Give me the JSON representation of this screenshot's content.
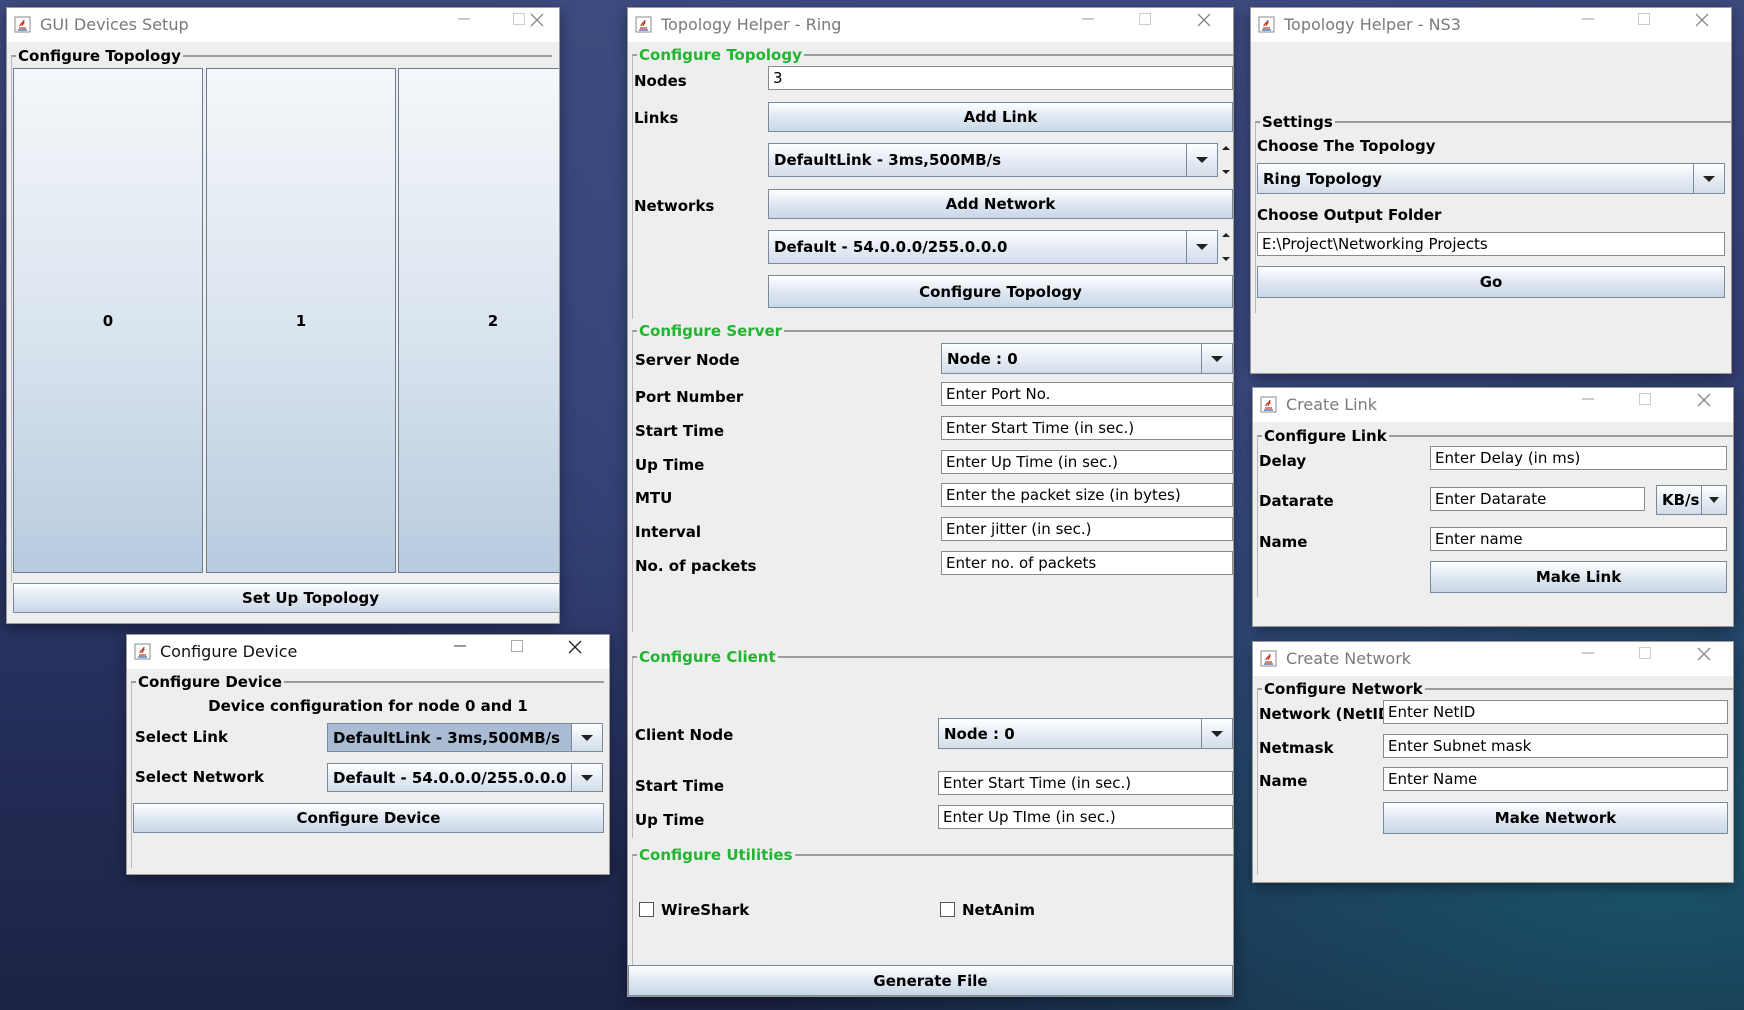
{
  "gui_devices": {
    "title": "GUI Devices Setup",
    "group": "Configure Topology",
    "nodes": [
      "0",
      "1",
      "2"
    ],
    "setup_button": "Set Up Topology"
  },
  "configure_device": {
    "title": "Configure Device",
    "group": "Configure Device",
    "info": "Device configuration for node 0 and 1",
    "select_link_label": "Select Link",
    "select_link_value": "DefaultLink - 3ms,500MB/s",
    "select_network_label": "Select Network",
    "select_network_value": "Default - 54.0.0.0/255.0.0.0",
    "button": "Configure Device"
  },
  "ring": {
    "title": "Topology Helper - Ring",
    "topology": {
      "group": "Configure Topology",
      "nodes_label": "Nodes",
      "nodes_value": "3",
      "links_label": "Links",
      "add_link": "Add Link",
      "link_value": "DefaultLink - 3ms,500MB/s",
      "networks_label": "Networks",
      "add_network": "Add Network",
      "network_value": "Default - 54.0.0.0/255.0.0.0",
      "configure_button": "Configure Topology"
    },
    "server": {
      "group": "Configure Server",
      "server_node_label": "Server Node",
      "server_node_value": "Node : 0",
      "port_label": "Port Number",
      "port_placeholder": "Enter Port No.",
      "start_label": "Start Time",
      "start_placeholder": "Enter Start Time (in sec.)",
      "up_label": "Up Time",
      "up_placeholder": "Enter Up Time (in sec.)",
      "mtu_label": "MTU",
      "mtu_placeholder": "Enter the packet size (in bytes)",
      "interval_label": "Interval",
      "interval_placeholder": "Enter jitter (in sec.)",
      "packets_label": "No. of packets",
      "packets_placeholder": "Enter no. of packets"
    },
    "client": {
      "group": "Configure Client",
      "client_node_label": "Client Node",
      "client_node_value": "Node : 0",
      "start_label": "Start Time",
      "start_placeholder": "Enter Start Time (in sec.)",
      "up_label": "Up Time",
      "up_placeholder": "Enter Up TIme (in sec.)"
    },
    "utilities": {
      "group": "Configure Utilities",
      "wireshark": "WireShark",
      "netanim": "NetAnim"
    },
    "generate_button": "Generate File"
  },
  "ns3": {
    "title": "Topology Helper - NS3",
    "group": "Settings",
    "choose_topology_label": "Choose The Topology",
    "topology_value": "Ring Topology",
    "choose_folder_label": "Choose Output Folder",
    "folder_value": "E:\\Project\\Networking Projects",
    "go_button": "Go"
  },
  "create_link": {
    "title": "Create Link",
    "group": "Configure Link",
    "delay_label": "Delay",
    "delay_placeholder": "Enter Delay (in ms)",
    "datarate_label": "Datarate",
    "datarate_placeholder": "Enter Datarate",
    "unit_value": "KB/s",
    "name_label": "Name",
    "name_placeholder": "Enter name",
    "button": "Make Link"
  },
  "create_network": {
    "title": "Create Network",
    "group": "Configure Network",
    "netid_label": "Network (NetID)",
    "netid_placeholder": "Enter NetID",
    "netmask_label": "Netmask",
    "netmask_placeholder": "Enter Subnet mask",
    "name_label": "Name",
    "name_placeholder": "Enter Name",
    "button": "Make Network"
  }
}
